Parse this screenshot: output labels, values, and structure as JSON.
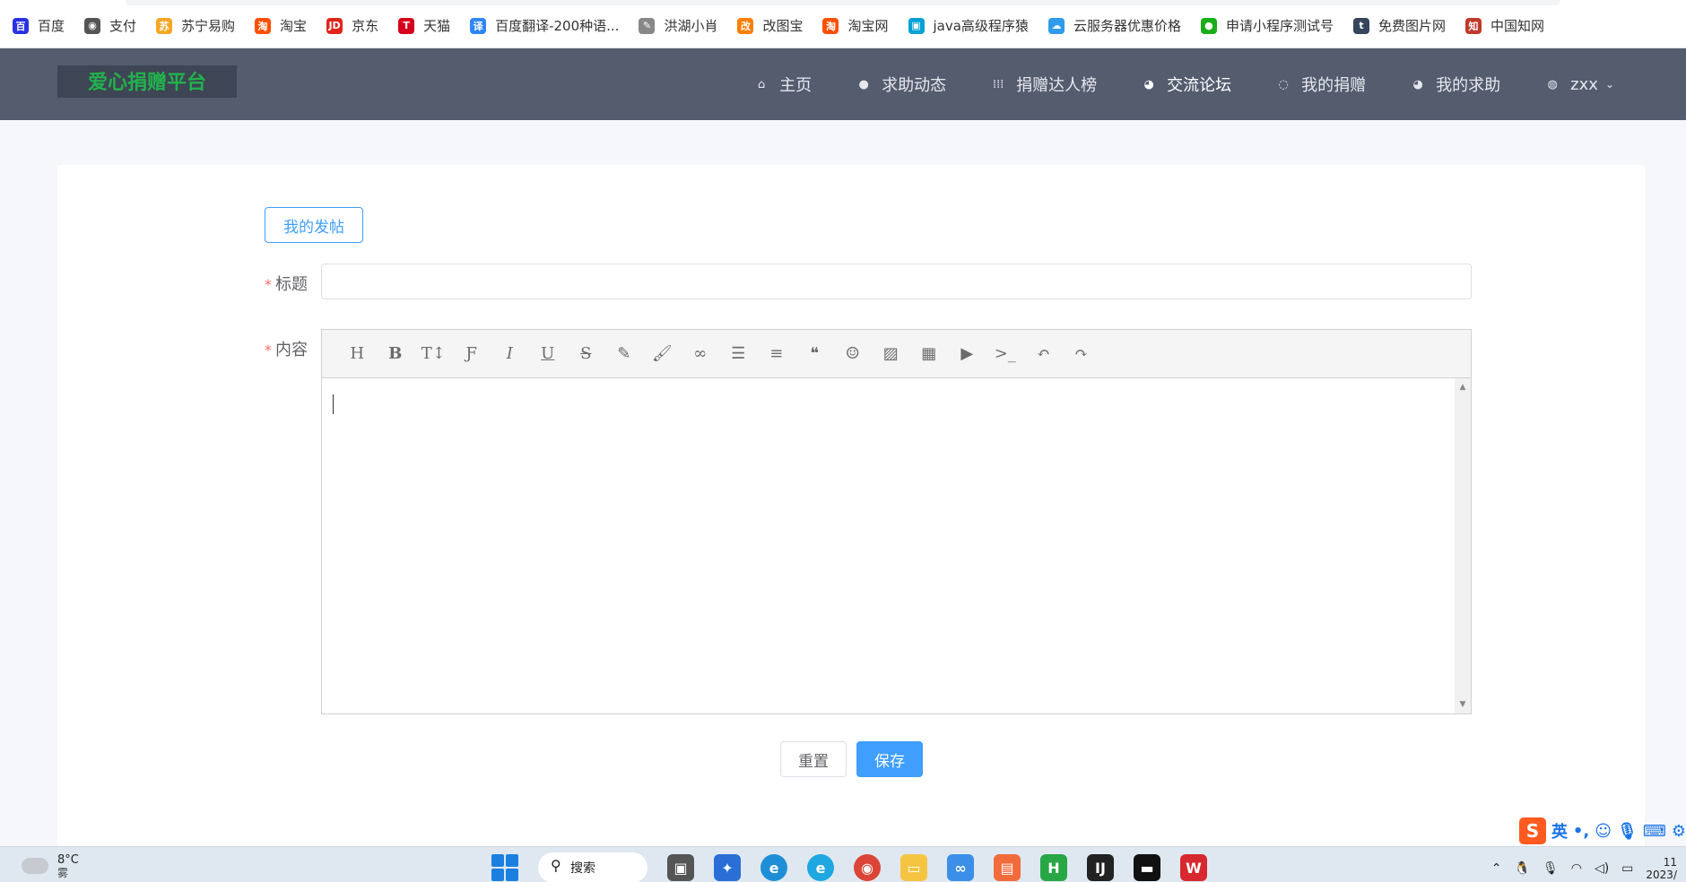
{
  "bookmarks": [
    {
      "label": "百度",
      "icon": "baidu-icon",
      "color": "#2932e1",
      "glyph": "百"
    },
    {
      "label": "支付",
      "icon": "globe-icon",
      "color": "#555555",
      "glyph": "◉"
    },
    {
      "label": "苏宁易购",
      "icon": "suning-icon",
      "color": "#f5a623",
      "glyph": "苏"
    },
    {
      "label": "淘宝",
      "icon": "taobao-icon",
      "color": "#ff5000",
      "glyph": "淘"
    },
    {
      "label": "京东",
      "icon": "jd-icon",
      "color": "#e1251b",
      "glyph": "JD"
    },
    {
      "label": "天猫",
      "icon": "tmall-icon",
      "color": "#d5001c",
      "glyph": "T"
    },
    {
      "label": "百度翻译-200种语...",
      "icon": "translate-icon",
      "color": "#2f86f6",
      "glyph": "译"
    },
    {
      "label": "洪湖小肖",
      "icon": "bird-icon",
      "color": "#888888",
      "glyph": "✎"
    },
    {
      "label": "改图宝",
      "icon": "gaitubao-icon",
      "color": "#ff7f00",
      "glyph": "改"
    },
    {
      "label": "淘宝网",
      "icon": "taobao-net-icon",
      "color": "#ff5000",
      "glyph": "淘"
    },
    {
      "label": "java高级程序猿",
      "icon": "bilibili-icon",
      "color": "#00a1d6",
      "glyph": "▣"
    },
    {
      "label": "云服务器优惠价格",
      "icon": "cloud-icon",
      "color": "#2f9bea",
      "glyph": "☁"
    },
    {
      "label": "申请小程序测试号",
      "icon": "wechat-icon",
      "color": "#1aad19",
      "glyph": "●"
    },
    {
      "label": "免费图片网",
      "icon": "tumblr-icon",
      "color": "#35465c",
      "glyph": "t"
    },
    {
      "label": "中国知网",
      "icon": "cnki-icon",
      "color": "#c0392b",
      "glyph": "知"
    }
  ],
  "header": {
    "logo": "爱心捐赠平台",
    "nav": [
      {
        "label": "主页",
        "icon": "home-icon",
        "glyph": "⌂"
      },
      {
        "label": "求助动态",
        "icon": "help-circle-icon",
        "glyph": "●"
      },
      {
        "label": "捐赠达人榜",
        "icon": "grid-icon",
        "glyph": "⁞⁞⁞"
      },
      {
        "label": "交流论坛",
        "icon": "forum-icon",
        "glyph": "◕"
      },
      {
        "label": "我的捐赠",
        "icon": "smile-icon",
        "glyph": "◌"
      },
      {
        "label": "我的求助",
        "icon": "chat-icon",
        "glyph": "◕"
      }
    ],
    "user": {
      "label": "zxx",
      "icon": "user-icon",
      "glyph": "◍"
    }
  },
  "form": {
    "my_posts_button": "我的发帖",
    "title_label": "标题",
    "title_value": "",
    "content_label": "内容",
    "required_mark": "*",
    "toolbar": [
      {
        "glyph": "H",
        "icon": "heading-icon"
      },
      {
        "glyph": "B",
        "icon": "bold-icon"
      },
      {
        "glyph": "T↕",
        "icon": "font-size-icon"
      },
      {
        "glyph": "Ƒ",
        "icon": "font-family-icon"
      },
      {
        "glyph": "I",
        "icon": "italic-icon"
      },
      {
        "glyph": "U",
        "icon": "underline-icon"
      },
      {
        "glyph": "S",
        "icon": "strikethrough-icon"
      },
      {
        "glyph": "✎",
        "icon": "text-color-icon"
      },
      {
        "glyph": "🖌",
        "icon": "background-color-icon"
      },
      {
        "glyph": "∞",
        "icon": "link-icon"
      },
      {
        "glyph": "☰",
        "icon": "list-icon"
      },
      {
        "glyph": "≡",
        "icon": "align-icon"
      },
      {
        "glyph": "❝",
        "icon": "quote-icon"
      },
      {
        "glyph": "☺",
        "icon": "emoticon-icon"
      },
      {
        "glyph": "▨",
        "icon": "image-icon"
      },
      {
        "glyph": "▦",
        "icon": "table-icon"
      },
      {
        "glyph": "▶",
        "icon": "video-icon"
      },
      {
        "glyph": ">_",
        "icon": "code-icon"
      },
      {
        "glyph": "↶",
        "icon": "undo-icon"
      },
      {
        "glyph": "↷",
        "icon": "redo-icon"
      }
    ],
    "reset_button": "重置",
    "save_button": "保存"
  },
  "ime": {
    "logo": "S",
    "mode": "英"
  },
  "taskbar": {
    "temperature": "8°C",
    "condition": "雾",
    "search_label": "搜索",
    "clock_time": "11",
    "clock_date": "2023/"
  },
  "colors": {
    "primary": "#409eff",
    "header": "#545c6e",
    "logo_text": "#22b14c"
  }
}
